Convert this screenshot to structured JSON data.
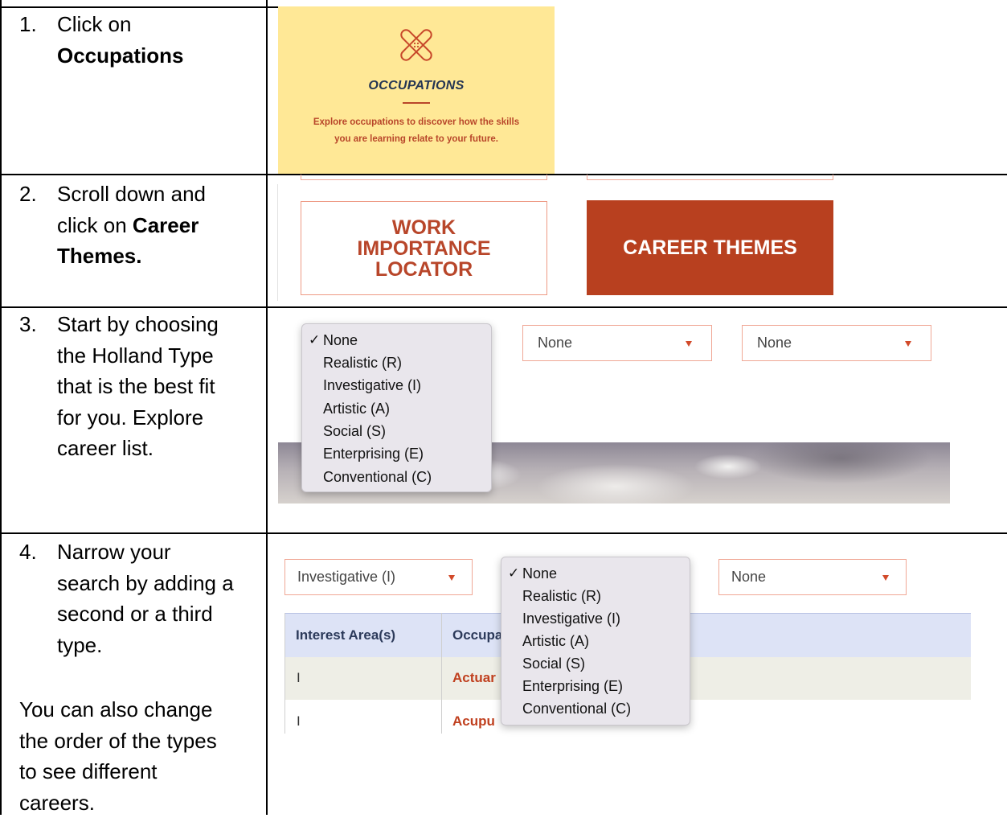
{
  "steps": [
    {
      "num": "1.",
      "lines": [
        "Click on",
        "Occupations"
      ],
      "bold_line": 1
    },
    {
      "num": "2.",
      "lines": [
        "Scroll down and",
        "click on ",
        "Career",
        "Themes."
      ]
    },
    {
      "num": "3.",
      "lines": [
        "Start by choosing",
        "the Holland Type",
        "that is the best fit",
        "for you. Explore",
        "career list."
      ]
    },
    {
      "num": "4.",
      "lines": [
        "Narrow your",
        "search by adding a",
        "second or a third",
        "type."
      ]
    }
  ],
  "note_lines": [
    "You can also change",
    "the order of the types",
    "to see different",
    "careers."
  ],
  "occupations_card": {
    "title": "OCCUPATIONS",
    "description": "Explore occupations to discover how the skills you are learning relate to your future."
  },
  "buttons": {
    "work_importance": "WORK IMPORTANCE LOCATOR",
    "career_themes": "CAREER THEMES"
  },
  "holland_options": [
    "None",
    "Realistic (R)",
    "Investigative (I)",
    "Artistic (A)",
    "Social (S)",
    "Enterprising (E)",
    "Conventional (C)"
  ],
  "checkmark": "✓",
  "row3_selects": [
    "None",
    "None"
  ],
  "row4_selects": {
    "first": "Investigative (I)",
    "third": "None"
  },
  "table": {
    "headers": [
      "Interest Area(s)",
      "Occupa"
    ],
    "rows": [
      {
        "area": "I",
        "occupation": "Actuar"
      },
      {
        "area": "I",
        "occupation": "Acupu"
      }
    ]
  },
  "colors": {
    "accent": "#b8401f",
    "card_bg": "#ffe896",
    "border": "#f0a896",
    "table_head": "#dde3f6"
  }
}
